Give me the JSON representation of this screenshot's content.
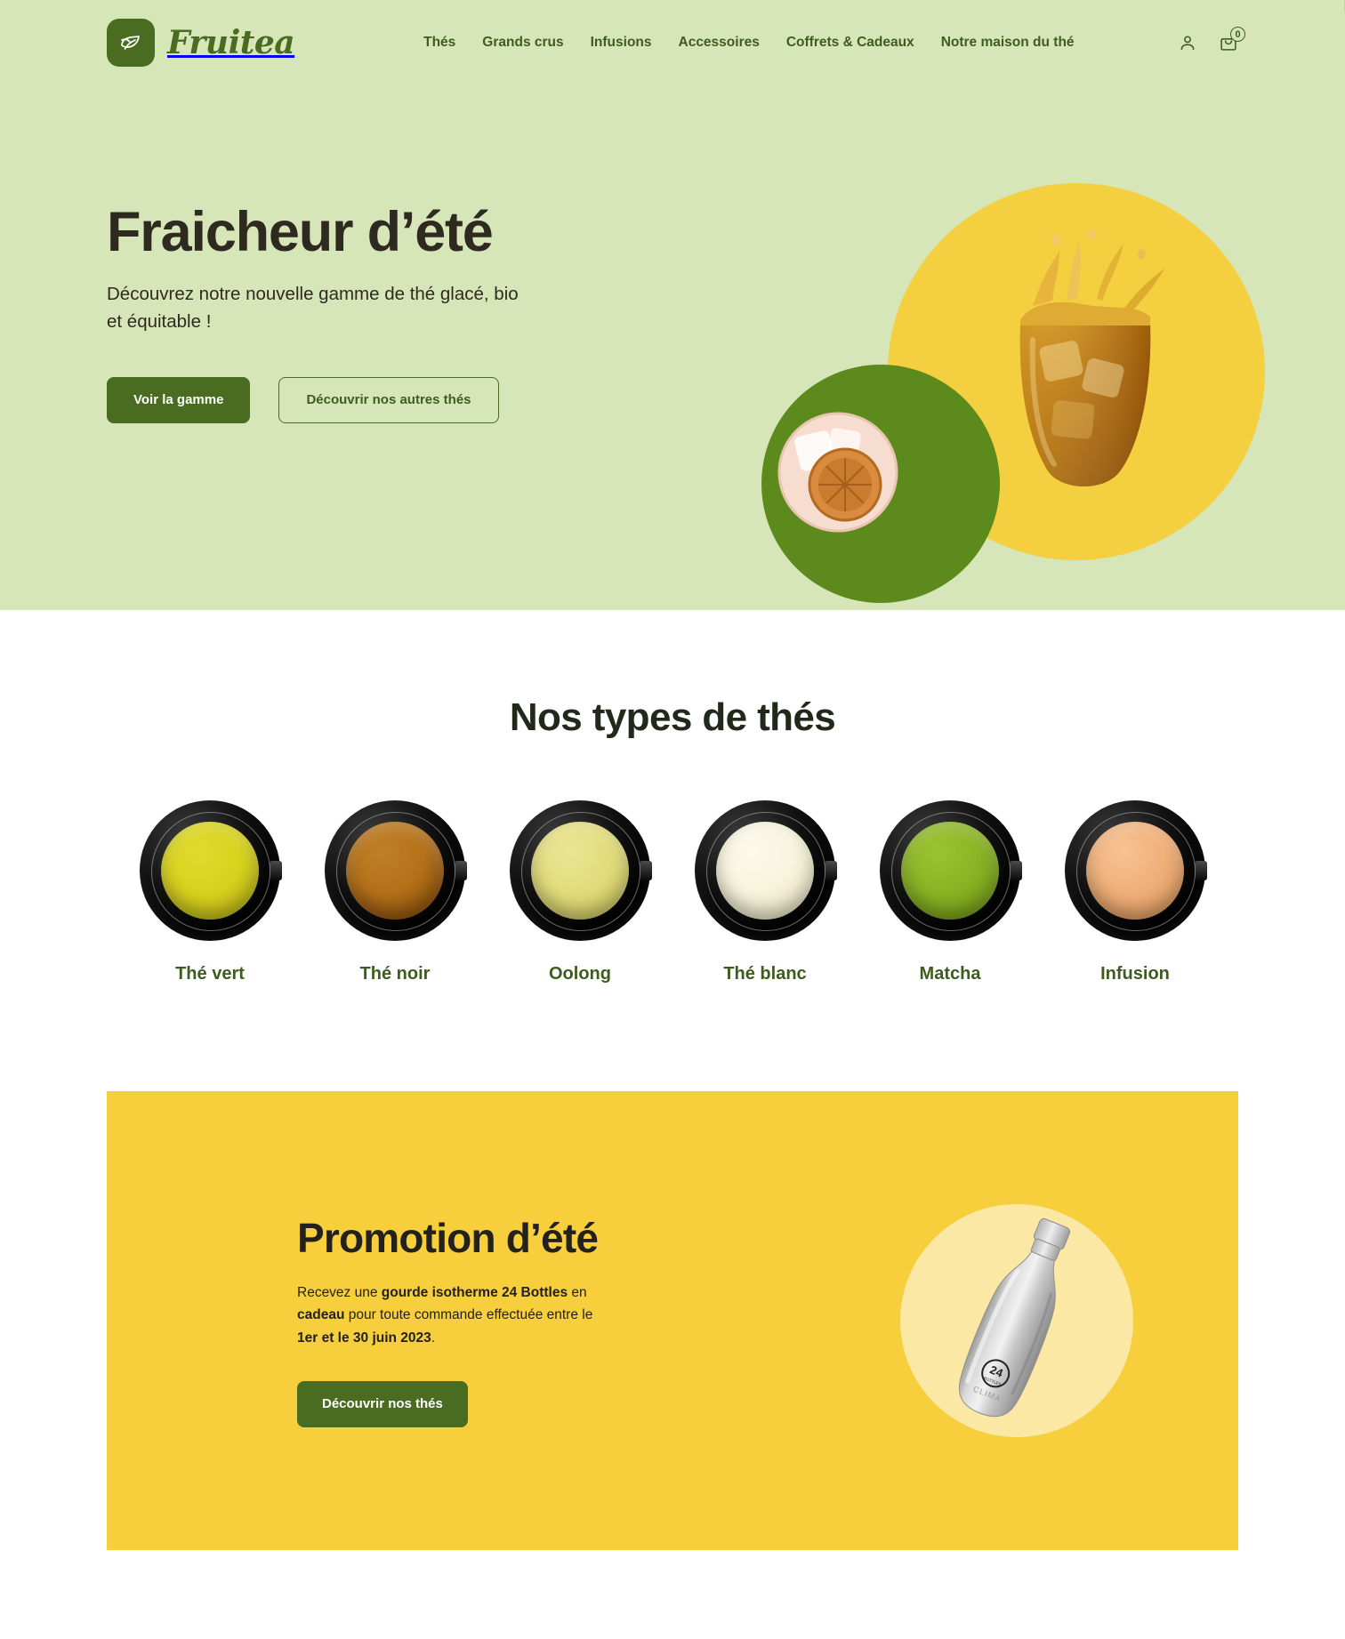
{
  "brand": {
    "name": "Fruitea",
    "logo_icon": "leaf-icon",
    "accent_green": "#4a6c21",
    "accent_yellow": "#f7cf3d",
    "hero_background": "#d7e6b9"
  },
  "header": {
    "nav": [
      {
        "label": "Thés"
      },
      {
        "label": "Grands crus"
      },
      {
        "label": "Infusions"
      },
      {
        "label": "Accessoires"
      },
      {
        "label": "Coffrets & Cadeaux"
      },
      {
        "label": "Notre maison du thé"
      }
    ],
    "account_icon": "user-icon",
    "cart_icon": "shopping-bag-icon",
    "cart_count": "0"
  },
  "hero": {
    "title": "Fraicheur d’été",
    "subtitle": "Découvrez notre nouvelle gamme de thé glacé, bio et équitable !",
    "primary_button": "Voir la gamme",
    "secondary_button": "Découvrir nos autres thés",
    "art": {
      "glass_image": "iced-tea-glass-splash",
      "lemon_image": "iced-drink-with-dried-orange",
      "circle_yellow": "#f4cf3f",
      "circle_green": "#5d8a1d"
    }
  },
  "types": {
    "title": "Nos types de thés",
    "items": [
      {
        "label": "Thé vert",
        "liquid_color": "#d8d21f",
        "liquid_color_2": "#b8b214"
      },
      {
        "label": "Thé noir",
        "liquid_color": "#b4711a",
        "liquid_color_2": "#7d4407"
      },
      {
        "label": "Oolong",
        "liquid_color": "#e2dc7c",
        "liquid_color_2": "#cac45c"
      },
      {
        "label": "Thé blanc",
        "liquid_color": "#f7f3dc",
        "liquid_color_2": "#e6e0bd"
      },
      {
        "label": "Matcha",
        "liquid_color": "#8ab424",
        "liquid_color_2": "#6d9614"
      },
      {
        "label": "Infusion",
        "liquid_color": "#f0b079",
        "liquid_color_2": "#dd9558"
      }
    ]
  },
  "promo": {
    "title": "Promotion d’été",
    "text_part_1": "Recevez une ",
    "text_bold_1": "gourde isotherme 24 Bottles",
    "text_part_2": " en ",
    "text_bold_2": "cadeau",
    "text_part_3": " pour toute commande effectuée entre le ",
    "text_bold_3": "1er et le 30 juin 2023",
    "text_part_4": ".",
    "button": "Découvrir nos thés",
    "product_image": "steel-water-bottle-24bottles-clima",
    "background": "#f7cf3d",
    "circle_color": "#fbe8a4"
  }
}
